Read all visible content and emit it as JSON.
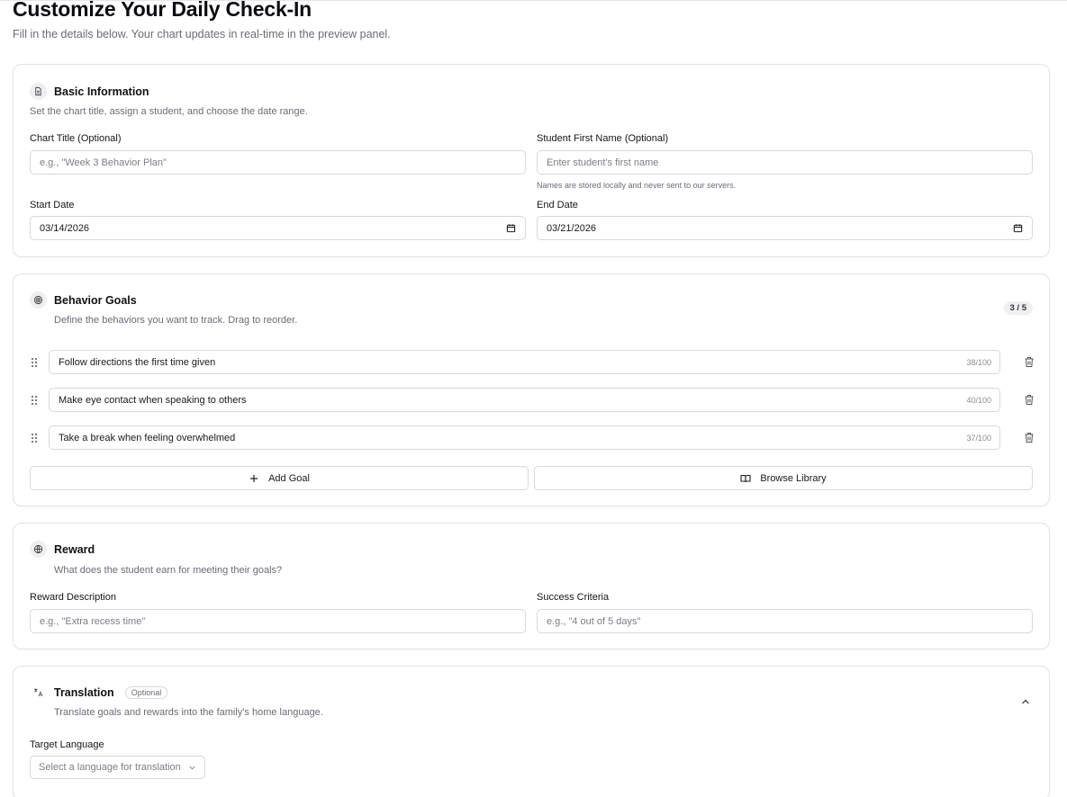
{
  "page": {
    "title": "Customize Your Daily Check-In",
    "subtitle": "Fill in the details below. Your chart updates in real-time in the preview panel."
  },
  "basic_info": {
    "icon": "document-icon",
    "title": "Basic Information",
    "description": "Set the chart title, assign a student, and choose the date range.",
    "chart_title_label": "Chart Title (Optional)",
    "chart_title_placeholder": "e.g., \"Week 3 Behavior Plan\"",
    "chart_title_value": "",
    "student_label": "Student First Name (Optional)",
    "student_placeholder": "Enter student's first name",
    "student_value": "",
    "student_help": "Names are stored locally and never sent to our servers.",
    "start_label": "Start Date",
    "start_value": "03/14/2026",
    "end_label": "End Date",
    "end_value": "03/21/2026"
  },
  "goals": {
    "icon": "target-icon",
    "title": "Behavior Goals",
    "description": "Define the behaviors you want to track. Drag to reorder.",
    "count_badge": "3 / 5",
    "items": [
      {
        "text": "Follow directions the first time given",
        "count": "38/100"
      },
      {
        "text": "Make eye contact when speaking to others",
        "count": "40/100"
      },
      {
        "text": "Take a break when feeling overwhelmed",
        "count": "37/100"
      }
    ],
    "add_label": "Add Goal",
    "browse_label": "Browse Library"
  },
  "reward": {
    "icon": "globe-icon",
    "title": "Reward",
    "description": "What does the student earn for meeting their goals?",
    "reward_label": "Reward Description",
    "reward_placeholder": "e.g., \"Extra recess time\"",
    "criteria_label": "Success Criteria",
    "criteria_placeholder": "e.g., \"4 out of 5 days\""
  },
  "translation": {
    "icon": "translate-icon",
    "title": "Translation",
    "optional_badge": "Optional",
    "description": "Translate goals and rewards into the family's home language.",
    "language_label": "Target Language",
    "language_placeholder": "Select a language for translation"
  }
}
